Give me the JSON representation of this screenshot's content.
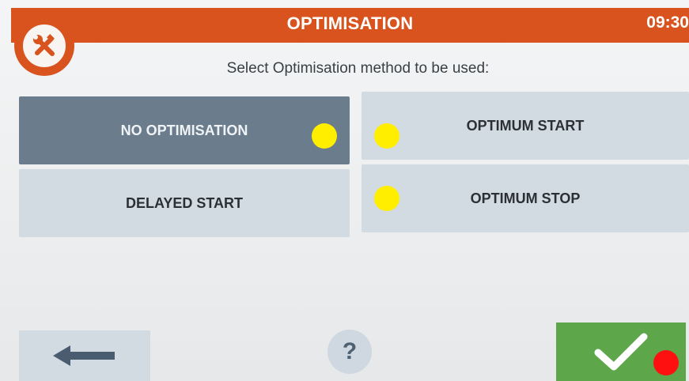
{
  "header": {
    "title": "OPTIMISATION",
    "time": "09:30",
    "background_color": "#d9531e",
    "settings_icon": "tools-icon"
  },
  "prompt": {
    "text": "Select Optimisation method to be used:"
  },
  "options": [
    {
      "label": "NO OPTIMISATION",
      "selected": true
    },
    {
      "label": "OPTIMUM START",
      "selected": false
    },
    {
      "label": "DELAYED START",
      "selected": false
    },
    {
      "label": "OPTIMUM STOP",
      "selected": false
    }
  ],
  "footer": {
    "back_icon": "arrow-left-icon",
    "help_label": "?",
    "confirm_icon": "checkmark-icon",
    "confirm_color": "#5da64a"
  },
  "colors": {
    "selected_option": "#6b7d8d",
    "unselected_option": "#d3dbe2",
    "marker_yellow": "#ffee00",
    "marker_red": "#ff1010"
  }
}
